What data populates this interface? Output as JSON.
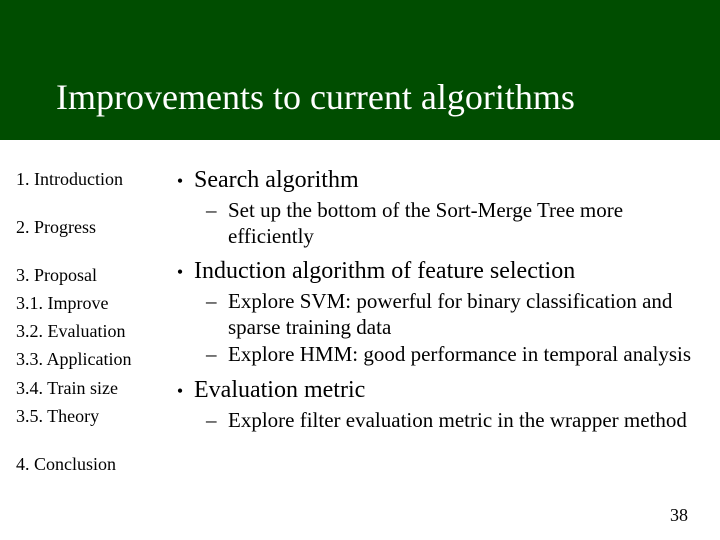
{
  "title": "Improvements to current algorithms",
  "sidebar": {
    "s1": "1. Introduction",
    "s2": "2. Progress",
    "s3": "3. Proposal",
    "s3_1": "3.1. Improve",
    "s3_2": "3.2. Evaluation",
    "s3_3": "3.3. Application",
    "s3_4": "3.4. Train size",
    "s3_5": "3.5. Theory",
    "s4": "4. Conclusion"
  },
  "content": {
    "b1": "Search algorithm",
    "b1_s1": "Set up the bottom of the Sort-Merge Tree more efficiently",
    "b2": "Induction algorithm of feature selection",
    "b2_s1": "Explore SVM: powerful for binary classification and sparse training data",
    "b2_s2": "Explore HMM: good performance in temporal analysis",
    "b3": "Evaluation metric",
    "b3_s1": "Explore filter evaluation metric in the wrapper method"
  },
  "page_number": "38"
}
